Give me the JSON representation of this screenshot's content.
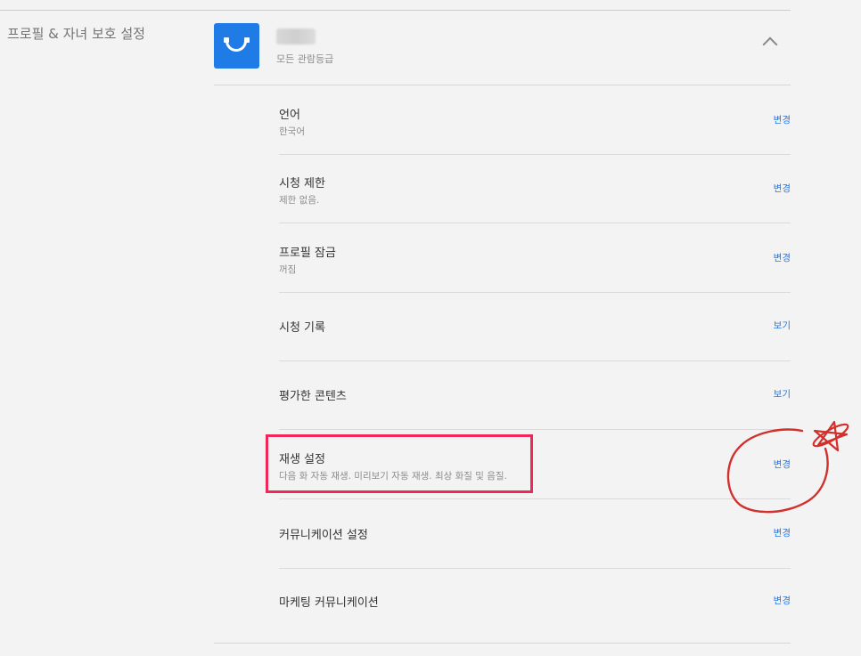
{
  "section": {
    "title": "프로필 & 자녀 보호 설정"
  },
  "profile": {
    "rating": "모든 관람등급"
  },
  "settings": [
    {
      "title": "언어",
      "subtitle": "한국어",
      "action": "변경"
    },
    {
      "title": "시청 제한",
      "subtitle": "제한 없음.",
      "action": "변경"
    },
    {
      "title": "프로필 잠금",
      "subtitle": "꺼짐",
      "action": "변경"
    },
    {
      "title": "시청 기록",
      "subtitle": "",
      "action": "보기"
    },
    {
      "title": "평가한 콘텐츠",
      "subtitle": "",
      "action": "보기"
    },
    {
      "title": "재생 설정",
      "subtitle": "다음 화 자동 재생. 미리보기 자동 재생. 최상 화질 및 음질.",
      "action": "변경"
    },
    {
      "title": "커뮤니케이션 설정",
      "subtitle": "",
      "action": "변경"
    },
    {
      "title": "마케팅 커뮤니케이션",
      "subtitle": "",
      "action": "변경"
    }
  ],
  "colors": {
    "accent": "#2d77dc",
    "avatar": "#1f7ce6",
    "highlight": "#f0285a",
    "annotation": "#d0312d"
  },
  "icons": {
    "avatar": "smiley-face-icon",
    "collapse": "chevron-up-icon"
  }
}
